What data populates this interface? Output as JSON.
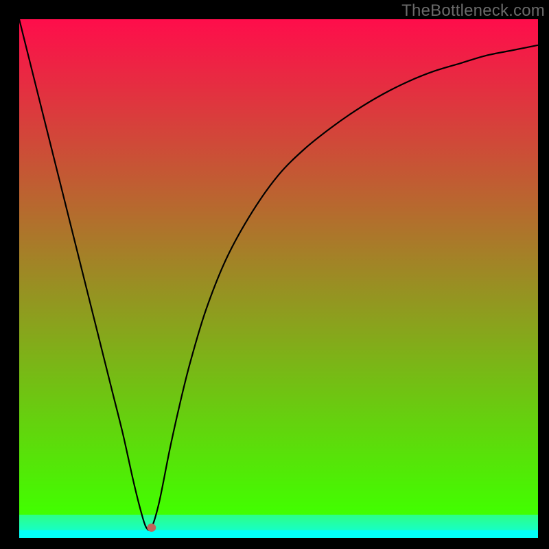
{
  "attribution": "TheBottleneck.com",
  "chart_data": {
    "type": "line",
    "title": "",
    "xlabel": "",
    "ylabel": "",
    "xlim": [
      0,
      100
    ],
    "ylim": [
      0,
      100
    ],
    "grid": false,
    "x": [
      0,
      2,
      4,
      6,
      8,
      10,
      12,
      14,
      16,
      18,
      20,
      22,
      23.5,
      24.5,
      25.5,
      27,
      29,
      31,
      33,
      36,
      40,
      45,
      50,
      55,
      60,
      65,
      70,
      75,
      80,
      85,
      90,
      95,
      100
    ],
    "values": [
      100,
      92,
      84,
      76,
      68,
      60,
      52,
      44,
      36,
      28,
      20,
      11,
      5,
      2,
      2,
      7,
      17,
      26,
      34,
      44,
      54,
      63,
      70,
      75,
      79,
      82.5,
      85.5,
      88,
      90,
      91.5,
      93,
      94,
      95
    ],
    "marker": {
      "x": 25.5,
      "y": 2
    },
    "gradient_bands": [
      {
        "from": 0.0,
        "to": 0.955,
        "top": "#ff0d4b",
        "bottom": "#41ff00"
      },
      {
        "from": 0.955,
        "to": 0.985,
        "top": "#2dff86",
        "bottom": "#17ffc4"
      },
      {
        "from": 0.985,
        "to": 1.0,
        "top": "#03fff9",
        "bottom": "#03fff9"
      }
    ],
    "colors": {
      "curve": "#000000",
      "marker": "#c1675a",
      "frame": "#000000"
    }
  }
}
